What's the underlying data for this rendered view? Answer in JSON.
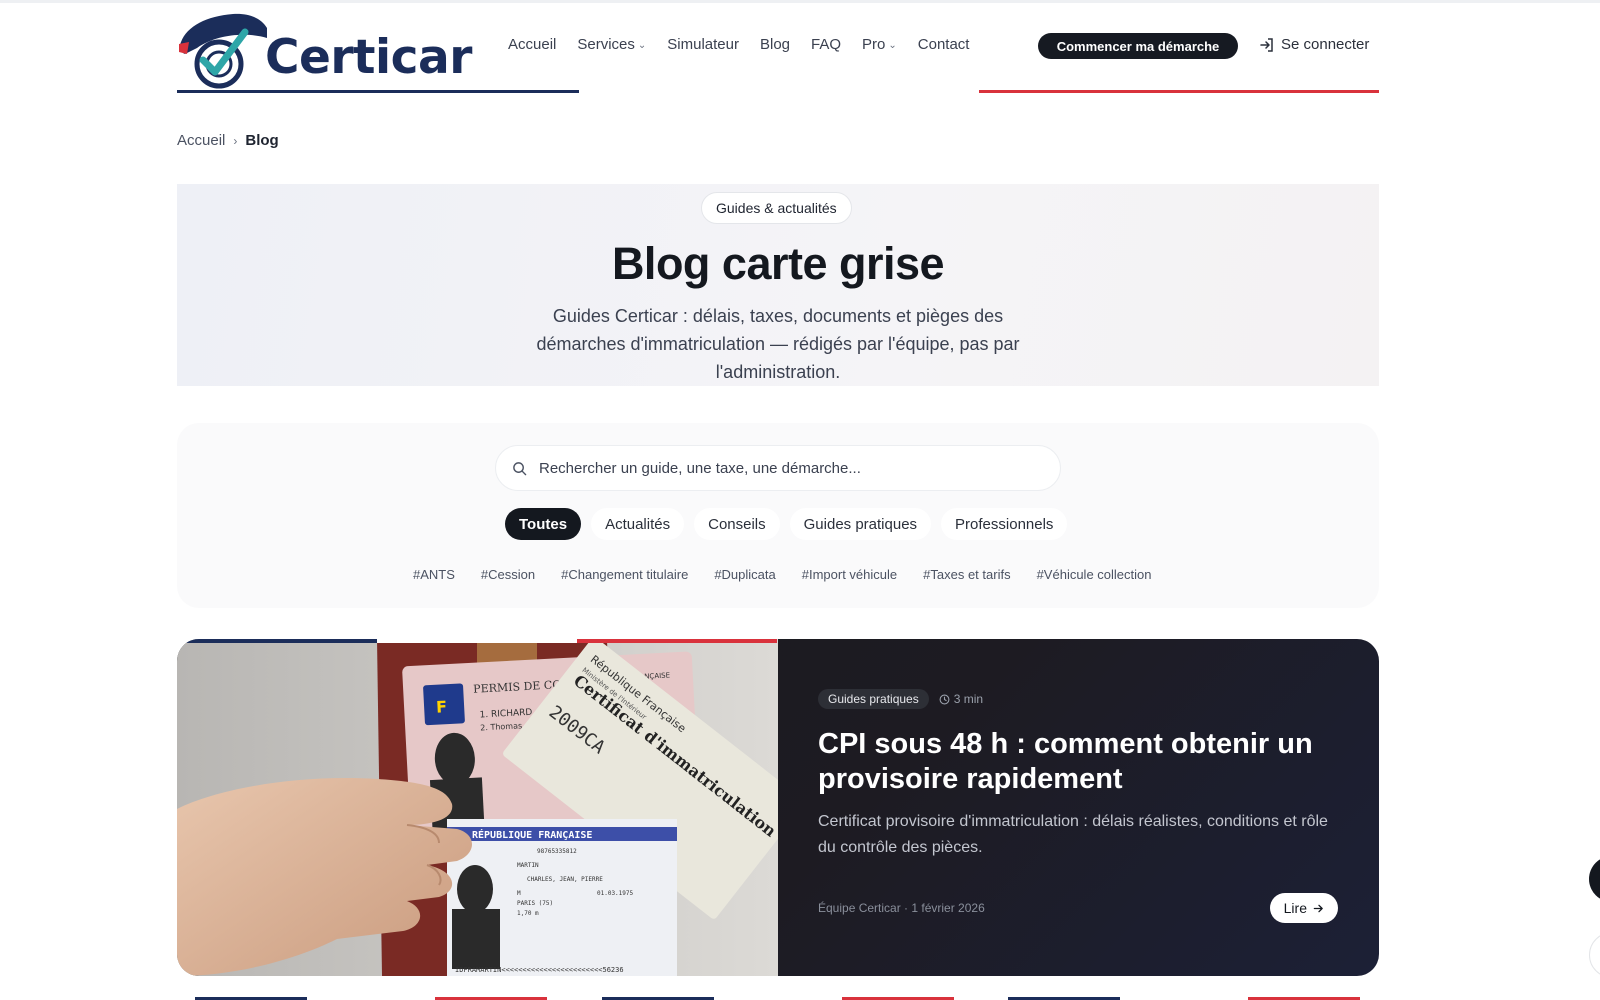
{
  "brand": {
    "name": "Certicar",
    "colors": {
      "navy": "#1b2d5a",
      "accent_red": "#d9323c",
      "teal": "#2ea6a8",
      "dark": "#14181f"
    }
  },
  "nav": {
    "items": [
      {
        "label": "Accueil",
        "dropdown": false
      },
      {
        "label": "Services",
        "dropdown": true
      },
      {
        "label": "Simulateur",
        "dropdown": false
      },
      {
        "label": "Blog",
        "dropdown": false
      },
      {
        "label": "FAQ",
        "dropdown": false
      },
      {
        "label": "Pro",
        "dropdown": true
      },
      {
        "label": "Contact",
        "dropdown": false
      }
    ],
    "cta_label": "Commencer ma démarche",
    "login_label": "Se connecter",
    "login_icon": "login-icon"
  },
  "breadcrumb": {
    "home": "Accueil",
    "current": "Blog"
  },
  "hero": {
    "badge": "Guides & actualités",
    "title": "Blog carte grise",
    "description": "Guides Certicar : délais, taxes, documents et pièges des démarches d'immatriculation — rédigés par l'équipe, pas par l'administration."
  },
  "search": {
    "placeholder": "Rechercher un guide, une taxe, une démarche...",
    "icon": "search-icon"
  },
  "filters": [
    {
      "label": "Toutes",
      "active": true
    },
    {
      "label": "Actualités",
      "active": false
    },
    {
      "label": "Conseils",
      "active": false
    },
    {
      "label": "Guides pratiques",
      "active": false
    },
    {
      "label": "Professionnels",
      "active": false
    }
  ],
  "tags": [
    "#ANTS",
    "#Cession",
    "#Changement titulaire",
    "#Duplicata",
    "#Import véhicule",
    "#Taxes et tarifs",
    "#Véhicule collection"
  ],
  "featured": {
    "category": "Guides pratiques",
    "read_time": "3 min",
    "title": "CPI sous 48 h : comment obtenir un provisoire rapidement",
    "description": "Certificat provisoire d'immatriculation : délais réalistes, conditions et rôle du contrôle des pièces.",
    "author_date": "Équipe Certicar · 1 février 2026",
    "read_label": "Lire",
    "image": {
      "license_title": "PERMIS DE CONDUIRE",
      "license_country": "FRANÇAISE",
      "license_name": "1. RICHARD",
      "license_firstname": "2. Thomas",
      "cert_title": "Certificat d'immatriculation",
      "cert_republic": "République Française",
      "cert_ministry": "Ministère de l'Intérieur",
      "cert_year": "2009CA",
      "card_band": "RÉPUBLIQUE FRANÇAISE",
      "card_number": "98765335812",
      "card_name": "MARTIN",
      "card_firstnames": "CHARLES, JEAN, PIERRE",
      "card_sex": "M",
      "card_birthdate": "01.03.1975",
      "card_birthplace": "PARIS (75)",
      "card_height": "1,70 m",
      "card_mrz": "IDFRAMARTIN<<<<<<<<<<<<<<<<<<<<<<<<56236"
    }
  }
}
